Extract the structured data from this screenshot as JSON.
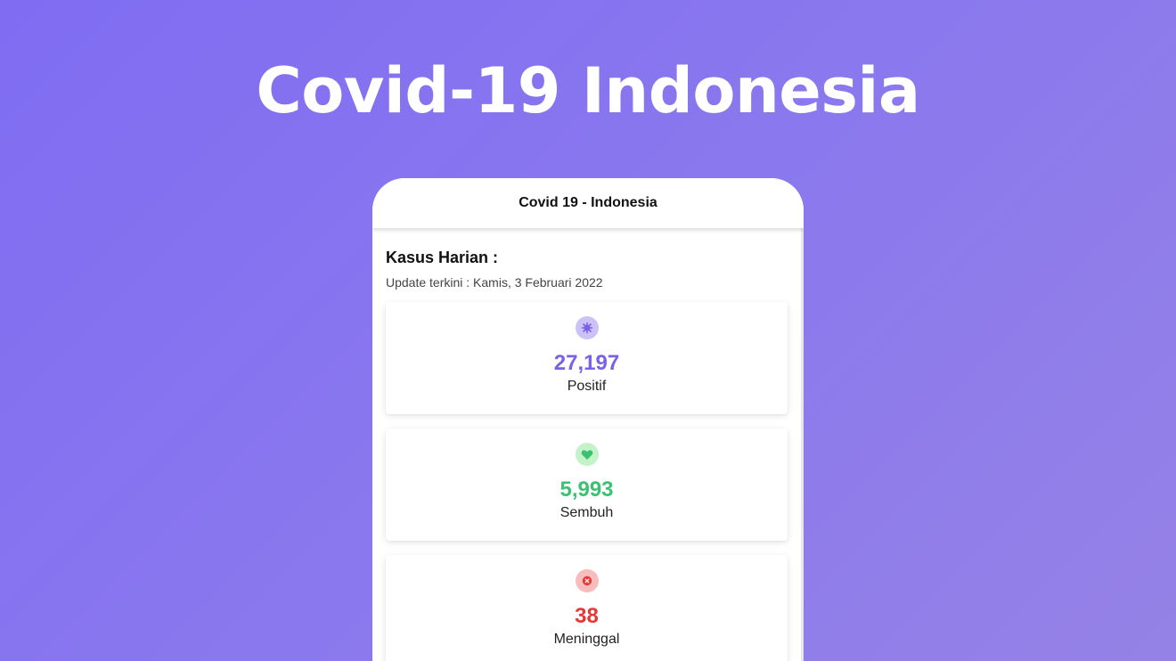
{
  "hero": {
    "title": "Covid-19 Indonesia"
  },
  "app": {
    "header_title": "Covid 19 - Indonesia",
    "section_title": "Kasus Harian :",
    "update_text": "Update terkini : Kamis, 3 Februari 2022"
  },
  "stats": [
    {
      "value": "27,197",
      "label": "Positif",
      "icon": "virus-icon",
      "color": "#7b61e8",
      "badge_color": "#cbc3f6"
    },
    {
      "value": "5,993",
      "label": "Sembuh",
      "icon": "heart-icon",
      "color": "#3cc173",
      "badge_color": "#c4f2c9"
    },
    {
      "value": "38",
      "label": "Meninggal",
      "icon": "close-circle-icon",
      "color": "#e53935",
      "badge_color": "#f7bcbc"
    }
  ]
}
